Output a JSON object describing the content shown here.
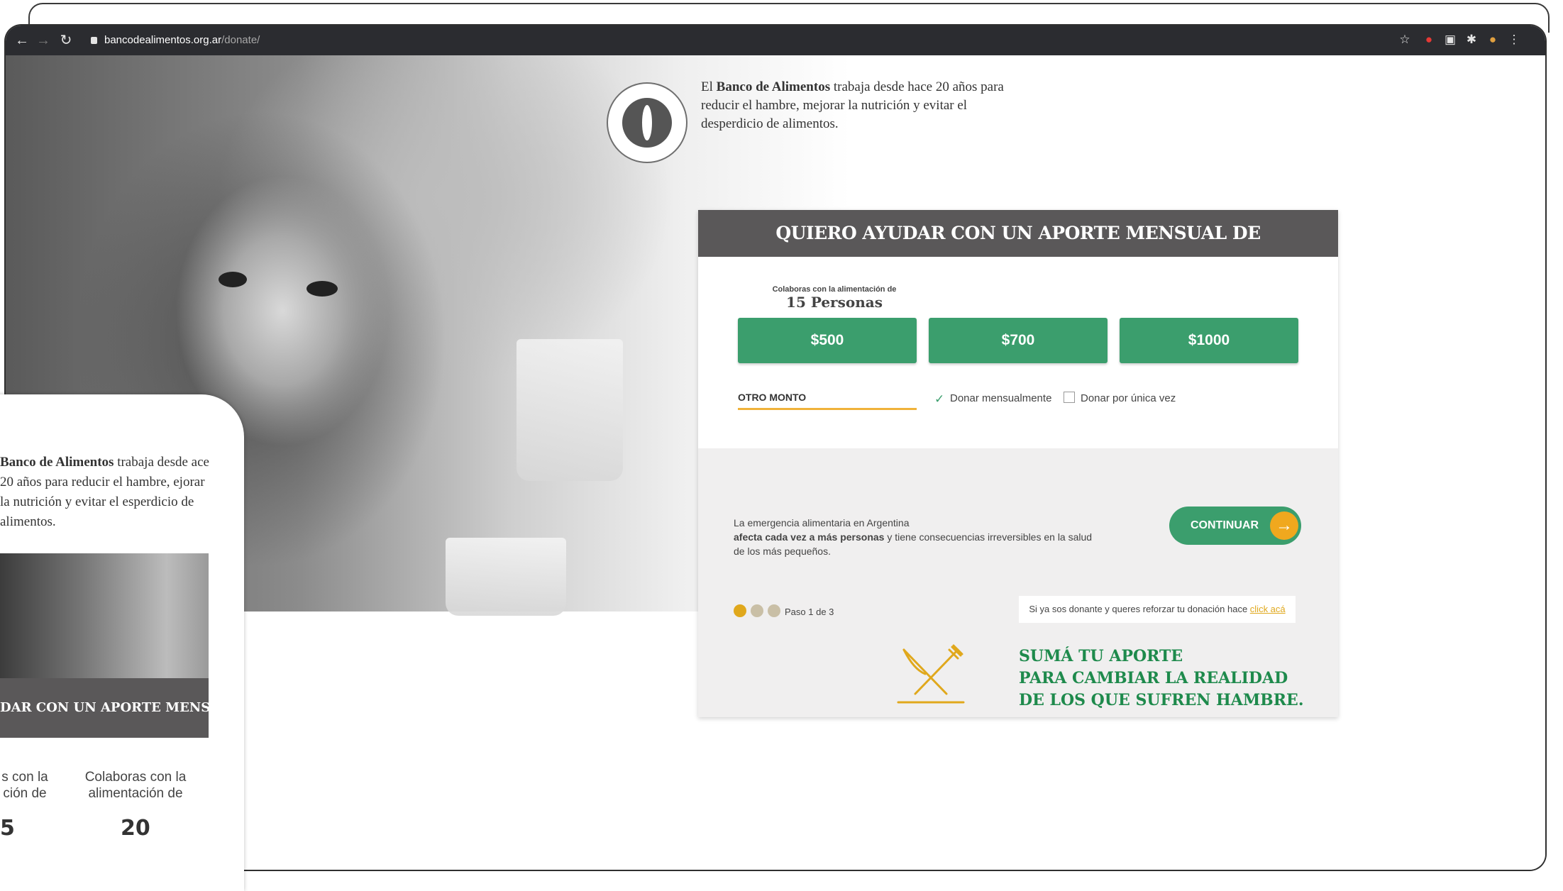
{
  "browser": {
    "url_host": "bancodealimentos.org.ar",
    "url_path": "/donate/"
  },
  "intro": {
    "prefix": "El ",
    "bold": "Banco de Alimentos",
    "rest": " trabaja desde hace 20 años para reducir el hambre, mejorar la nutrición y evitar el desperdicio de alimentos."
  },
  "form": {
    "title": "QUIERO AYUDAR CON UN APORTE MENSUAL DE",
    "colab_small": "Colaboras con la alimentación de",
    "colab_big": "15 Personas",
    "amounts": [
      "$500",
      "$700",
      "$1000"
    ],
    "otro_monto": "OTRO MONTO",
    "opt_monthly": "Donar mensualmente",
    "opt_once": "Donar por única vez",
    "msg_line1": "La emergencia alimentaria en Argentina",
    "msg_bold": "afecta cada vez a más personas",
    "msg_rest": " y tiene consecuencias irreversibles en la salud de los más pequeños.",
    "continue_label": "CONTINUAR",
    "step_label": "Paso 1 de 3",
    "donante_text": "Si ya sos donante y queres reforzar tu donación hace ",
    "donante_link": "click acá",
    "slogan": [
      "SUMÁ TU APORTE",
      "PARA CAMBIAR LA REALIDAD",
      "DE LOS QUE SUFREN HAMBRE."
    ]
  },
  "mobile": {
    "intro_bold": "Banco de Alimentos",
    "intro_rest": " trabaja desde ace 20 años para reducir el hambre, ejorar la nutrición y evitar el esperdicio de alimentos.",
    "title": "DAR CON UN APORTE MENSUAL DE",
    "col1_text": "s con la ción de",
    "col1_num": "5",
    "col2_text": "Colaboras con la alimentación de",
    "col2_num": "20"
  },
  "colors": {
    "green": "#3b9e6d",
    "dark_green": "#1e8a4c",
    "gold": "#e0a81c",
    "header_gray": "#5a5859"
  }
}
